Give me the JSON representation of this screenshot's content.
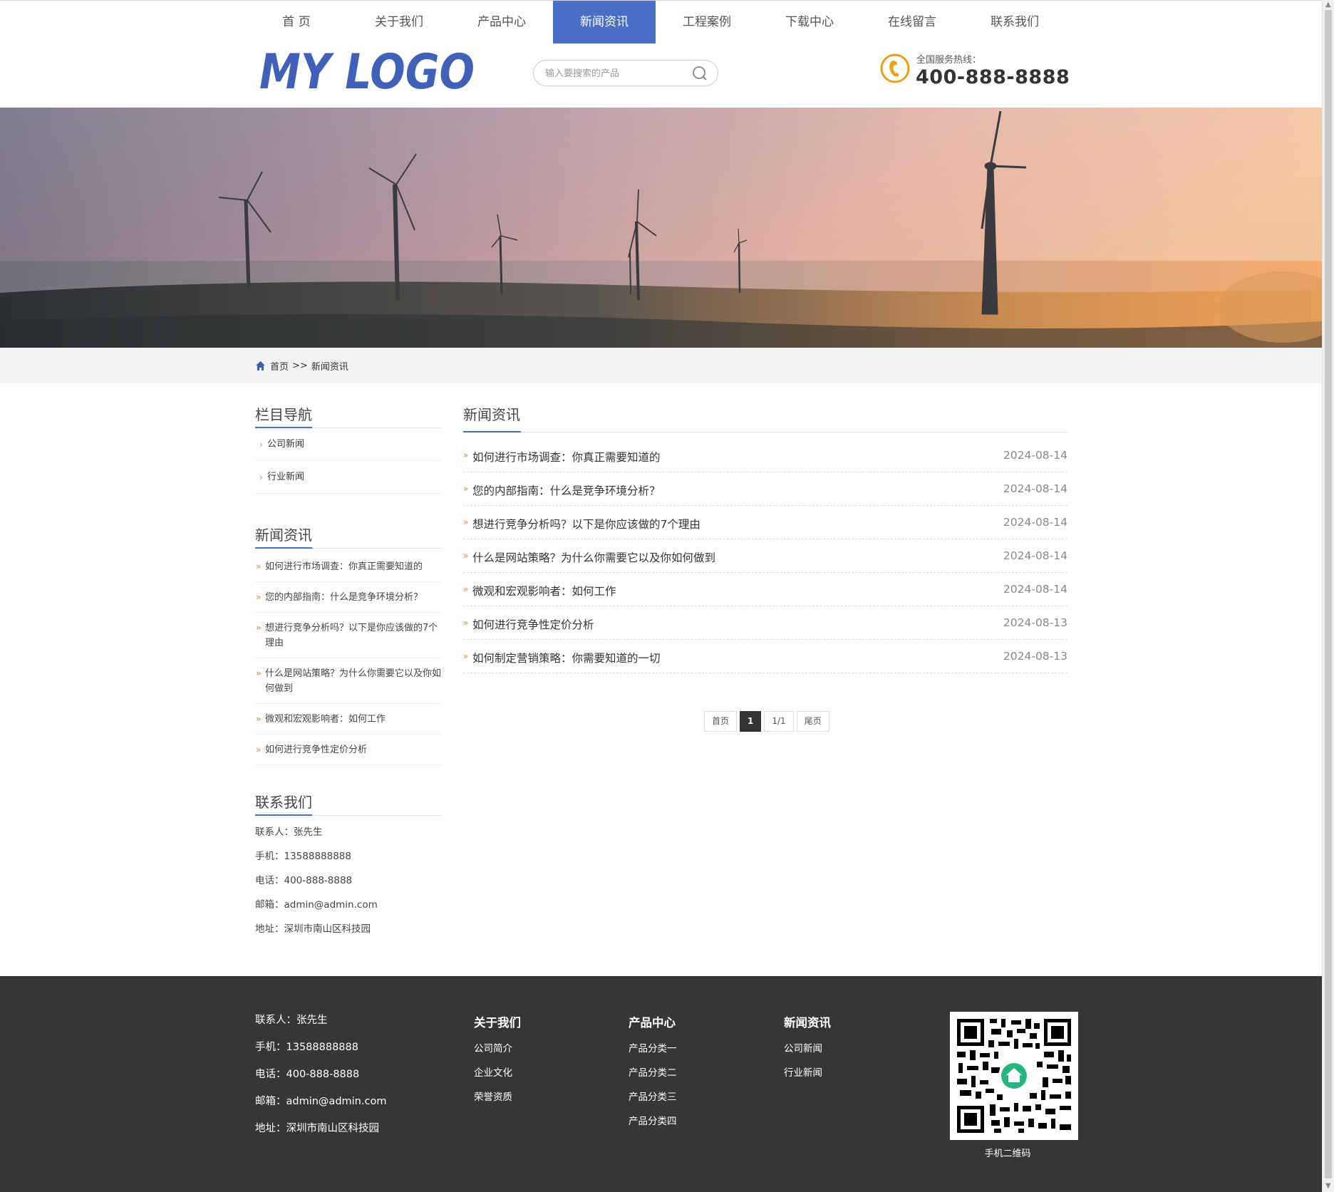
{
  "header": {
    "nav": [
      "首 页",
      "关于我们",
      "产品中心",
      "新闻资讯",
      "工程案例",
      "下载中心",
      "在线留言",
      "联系我们"
    ],
    "active_nav_index": 3,
    "logo_text": "MY LOGO",
    "search_placeholder": "输入要搜索的产品",
    "hotline_label": "全国服务热线：",
    "hotline_number": "400-888-8888"
  },
  "breadcrumb": {
    "home": "首页",
    "separator": ">>",
    "current": "新闻资讯"
  },
  "sidebar": {
    "nav_title": "栏目导航",
    "categories": [
      "公司新闻",
      "行业新闻"
    ],
    "news_title": "新闻资讯",
    "news": [
      "如何进行市场调查：你真正需要知道的",
      "您的内部指南：什么是竞争环境分析？",
      "想进行竞争分析吗？以下是你应该做的7个理由",
      "什么是网站策略？为什么你需要它以及你如何做到",
      "微观和宏观影响者：如何工作",
      "如何进行竞争性定价分析"
    ],
    "contact_title": "联系我们",
    "contact": [
      "联系人：张先生",
      "手机：13588888888",
      "电话：400-888-8888",
      "邮箱：admin@admin.com",
      "地址：深圳市南山区科技园"
    ]
  },
  "main": {
    "title": "新闻资讯",
    "items": [
      {
        "title": "如何进行市场调查：你真正需要知道的",
        "date": "2024-08-14"
      },
      {
        "title": "您的内部指南：什么是竞争环境分析？",
        "date": "2024-08-14"
      },
      {
        "title": "想进行竞争分析吗？以下是你应该做的7个理由",
        "date": "2024-08-14"
      },
      {
        "title": "什么是网站策略？为什么你需要它以及你如何做到",
        "date": "2024-08-14"
      },
      {
        "title": "微观和宏观影响者：如何工作",
        "date": "2024-08-14"
      },
      {
        "title": "如何进行竞争性定价分析",
        "date": "2024-08-13"
      },
      {
        "title": "如何制定营销策略：你需要知道的一切",
        "date": "2024-08-13"
      }
    ],
    "pager": {
      "first": "首页",
      "current": "1",
      "info": "1/1",
      "last": "尾页"
    }
  },
  "footer": {
    "contact": [
      "联系人：张先生",
      "手机：13588888888",
      "电话：400-888-8888",
      "邮箱：admin@admin.com",
      "地址：深圳市南山区科技园"
    ],
    "columns": [
      {
        "heading": "关于我们",
        "links": [
          "公司简介",
          "企业文化",
          "荣誉资质"
        ]
      },
      {
        "heading": "产品中心",
        "links": [
          "产品分类一",
          "产品分类二",
          "产品分类三",
          "产品分类四"
        ]
      },
      {
        "heading": "新闻资讯",
        "links": [
          "公司新闻",
          "行业新闻"
        ]
      }
    ],
    "qr_caption": "手机二维码"
  },
  "colors": {
    "accent": "#4b6fc4",
    "footer_bg": "#363636",
    "arrow": "#d08a3a",
    "hotline_icon": "#e6a21b"
  },
  "icons": [
    "search-icon",
    "phone-icon",
    "home-icon",
    "qr-code"
  ]
}
